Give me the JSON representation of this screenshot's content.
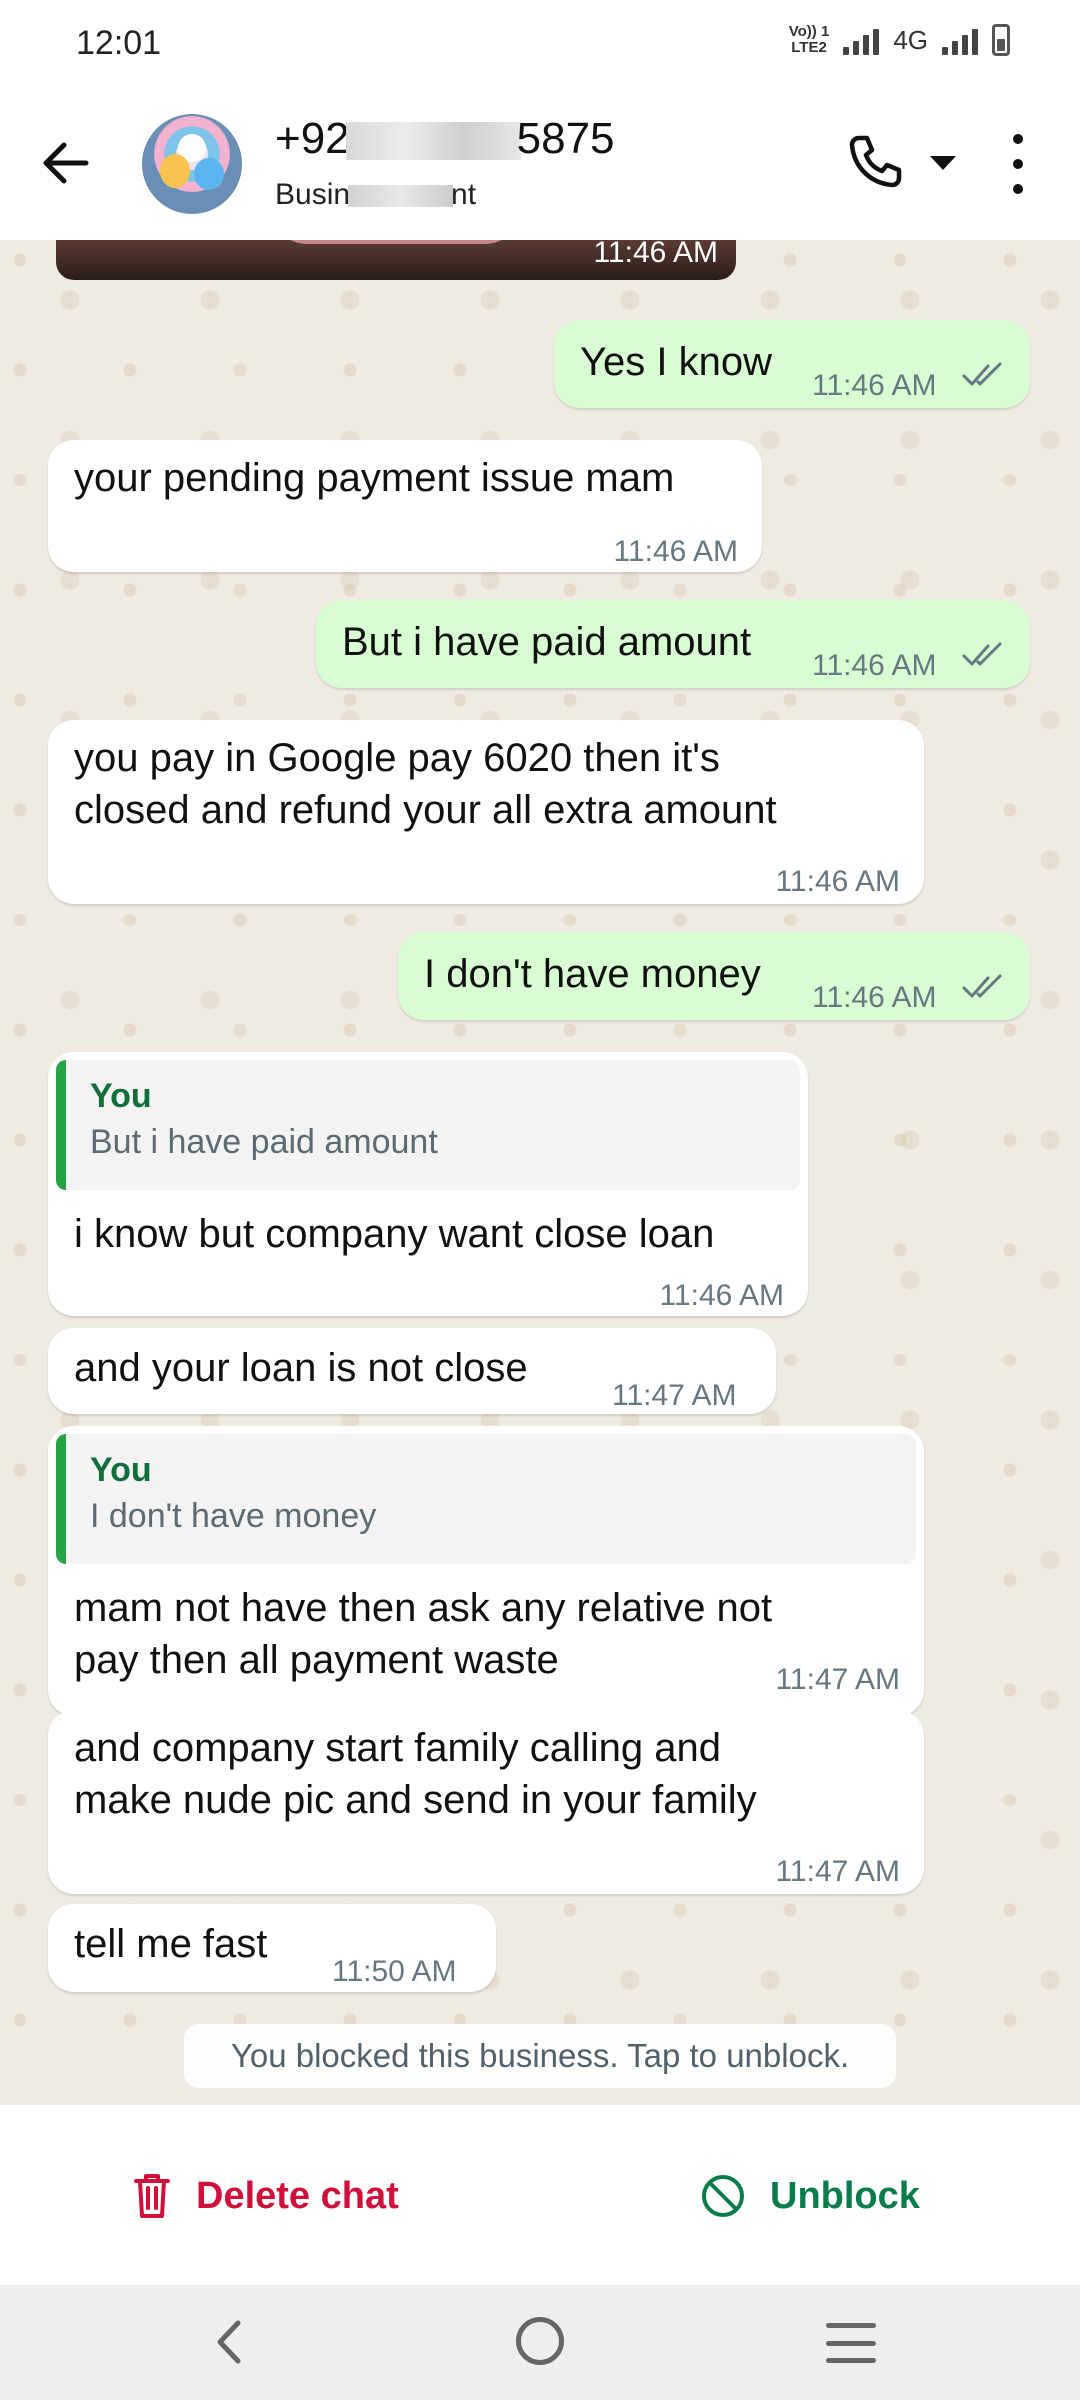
{
  "status_bar": {
    "time": "12:01",
    "volte": "Vo)) 1",
    "volte_sub": "LTE2",
    "network": "4G"
  },
  "header": {
    "name_prefix": "+92",
    "name_suffix": "5875",
    "subtitle_prefix": "Busin",
    "subtitle_suffix": "nt",
    "icons": [
      "back-arrow-icon",
      "call-icon",
      "caret-down-icon",
      "more-vert-icon"
    ]
  },
  "chat": {
    "image_time": "11:46 AM",
    "messages": [
      {
        "dir": "out",
        "text": "Yes I know",
        "time": "11:46 AM",
        "read": true
      },
      {
        "dir": "in",
        "text": "your pending payment issue mam",
        "time": "11:46 AM"
      },
      {
        "dir": "out",
        "text": "But i have paid amount",
        "time": "11:46 AM",
        "read": true
      },
      {
        "dir": "in",
        "text_lines": [
          "you pay in Google pay 6020 then it's",
          "closed and refund your all extra amount"
        ],
        "time": "11:46 AM"
      },
      {
        "dir": "out",
        "text": "I don't have money",
        "time": "11:46 AM",
        "read": true
      },
      {
        "dir": "in",
        "quote_author": "You",
        "quote_text": "But i have paid amount",
        "text": "i know but company want close loan",
        "time": "11:46 AM"
      },
      {
        "dir": "in",
        "text": "and your loan is not close",
        "time": "11:47 AM"
      },
      {
        "dir": "in",
        "quote_author": "You",
        "quote_text": "I don't have money",
        "text_lines": [
          "mam not have then ask any relative not",
          "pay then all payment waste"
        ],
        "time": "11:47 AM"
      },
      {
        "dir": "in",
        "text_lines": [
          "and company start family calling and",
          "make nude pic and send in your family"
        ],
        "time": "11:47 AM"
      },
      {
        "dir": "in",
        "text": "tell me fast",
        "time": "11:50 AM"
      }
    ],
    "system_note": "You blocked this business. Tap to unblock."
  },
  "actions": {
    "delete_label": "Delete chat",
    "unblock_label": "Unblock",
    "delete_color": "#d0103a",
    "unblock_color": "#0a7b4a"
  },
  "colors": {
    "outgoing_bubble": "#d9fdd3",
    "incoming_bubble": "#ffffff",
    "chat_background": "#efeae2",
    "quote_bar": "#25a244"
  }
}
